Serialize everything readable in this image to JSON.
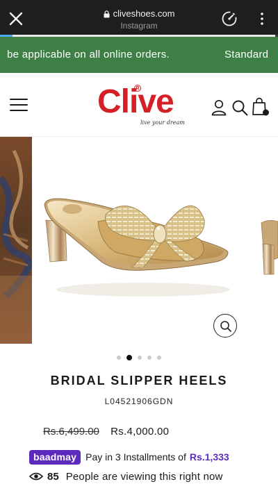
{
  "browser": {
    "url": "cliveshoes.com",
    "source_app": "Instagram",
    "icons": [
      "close-icon",
      "lock-icon",
      "speed-icon",
      "more-vertical-icon"
    ],
    "load_progress": 0.99
  },
  "announcement": {
    "text_1": "be applicable on all online orders.",
    "text_2": "Standard",
    "background": "#3e7f45"
  },
  "header": {
    "logo_text": "Clive",
    "logo_tagline": "live your dream",
    "icons": [
      "menu-icon",
      "user-icon",
      "search-icon",
      "cart-icon"
    ],
    "brand_color": "#d42027"
  },
  "gallery": {
    "slide_count": 5,
    "active_slide": 2,
    "zoom_icon": "zoom-icon"
  },
  "product": {
    "title": "BRIDAL SLIPPER HEELS",
    "sku": "L04521906GDN",
    "compare_price": "Rs.6,499.00",
    "price": "Rs.4,000.00"
  },
  "installments": {
    "badge": "baadmay",
    "text": "Pay in 3 Installments of",
    "amount": "Rs.1,333",
    "accent": "#5b2bbd"
  },
  "viewers": {
    "count": "85",
    "text": "People are viewing this right now"
  }
}
